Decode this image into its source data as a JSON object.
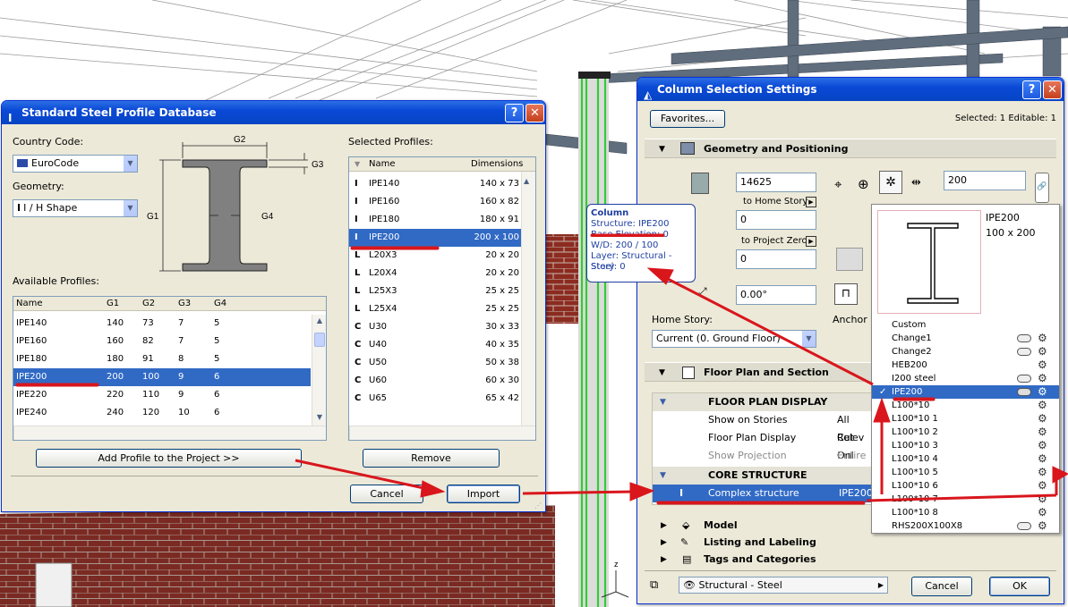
{
  "colors": {
    "selection": "#316ac5",
    "title_bar": "#0a49d6",
    "annotation": "#d9161c",
    "structural": "#33cc33",
    "brick": "#8c2b20"
  },
  "left_dialog": {
    "title": "Standard Steel Profile Database",
    "icon": "i-beam-icon",
    "country_code_label": "Country Code:",
    "country_code_value": "EuroCode",
    "geometry_label": "Geometry:",
    "geometry_value": "I / H Shape",
    "diagram": {
      "g1": "G1",
      "g2": "G2",
      "g3": "G3",
      "g4": "G4"
    },
    "available_label": "Available Profiles:",
    "available_headers": [
      "Name",
      "G1",
      "G2",
      "G3",
      "G4"
    ],
    "available_rows": [
      [
        "IPE140",
        "140",
        "73",
        "7",
        "5"
      ],
      [
        "IPE160",
        "160",
        "82",
        "7",
        "5"
      ],
      [
        "IPE180",
        "180",
        "91",
        "8",
        "5"
      ],
      [
        "IPE200",
        "200",
        "100",
        "9",
        "6"
      ],
      [
        "IPE220",
        "220",
        "110",
        "9",
        "6"
      ],
      [
        "IPE240",
        "240",
        "120",
        "10",
        "6"
      ]
    ],
    "available_selected": 3,
    "selected_label": "Selected Profiles:",
    "selected_headers": [
      "Name",
      "Dimensions"
    ],
    "selected_rows": [
      {
        "icon": "i",
        "name": "IPE140",
        "dim": "140 x 73"
      },
      {
        "icon": "i",
        "name": "IPE160",
        "dim": "160 x 82"
      },
      {
        "icon": "i",
        "name": "IPE180",
        "dim": "180 x 91"
      },
      {
        "icon": "i",
        "name": "IPE200",
        "dim": "200 x 100"
      },
      {
        "icon": "l",
        "name": "L20X3",
        "dim": "20 x 20"
      },
      {
        "icon": "l",
        "name": "L20X4",
        "dim": "20 x 20"
      },
      {
        "icon": "l",
        "name": "L25X3",
        "dim": "25 x 25"
      },
      {
        "icon": "l",
        "name": "L25X4",
        "dim": "25 x 25"
      },
      {
        "icon": "u",
        "name": "U30",
        "dim": "30 x 33"
      },
      {
        "icon": "u",
        "name": "U40",
        "dim": "40 x 35"
      },
      {
        "icon": "u",
        "name": "U50",
        "dim": "50 x 38"
      },
      {
        "icon": "u",
        "name": "U60",
        "dim": "60 x 30"
      },
      {
        "icon": "u",
        "name": "U65",
        "dim": "65 x 42"
      }
    ],
    "selected_selected": 3,
    "add_button": "Add Profile to the Project >>",
    "remove_button": "Remove",
    "cancel_button": "Cancel",
    "import_button": "Import"
  },
  "tooltip": {
    "title": "Column",
    "lines": [
      "Structure: IPE200",
      "Base Elevation: 0",
      "W/D: 200 / 100",
      "Layer: Structural - Steel",
      "Story: 0"
    ]
  },
  "right_dialog": {
    "title": "Column Selection Settings",
    "favorites": "Favorites...",
    "selected_info": "Selected: 1 Editable: 1",
    "geometry_section": "Geometry and Positioning",
    "height_value": "14625",
    "to_home_story": "to Home Story",
    "home_offset_value": "0",
    "to_project_zero": "to Project Zero",
    "project_zero_value": "0",
    "angle_value": "0.00°",
    "width_value": "200",
    "home_story_label": "Home Story:",
    "home_story_value": "Current (0. Ground Floor)",
    "anchor_label": "Anchor P",
    "floor_plan_section": "Floor Plan and Section",
    "floor_plan_display_hdr": "FLOOR PLAN DISPLAY",
    "fp_rows": [
      {
        "label": "Show on Stories",
        "value": "All Relev"
      },
      {
        "label": "Floor Plan Display",
        "value": "Cut Onl"
      },
      {
        "label": "Show Projection",
        "value": "Entire E"
      }
    ],
    "core_structure_hdr": "CORE STRUCTURE",
    "complex_label": "Complex structure",
    "complex_value": "IPE200",
    "model_section": "Model",
    "listing_section": "Listing and Labeling",
    "tags_section": "Tags and Categories",
    "layer_value": "Structural - Steel",
    "cancel_button": "Cancel",
    "ok_button": "OK"
  },
  "profile_popup": {
    "preview_name": "IPE200",
    "preview_dim": "100 x 200",
    "items": [
      {
        "name": "Custom",
        "disk": false,
        "gear": false
      },
      {
        "name": "Change1",
        "disk": true,
        "gear": true
      },
      {
        "name": "Change2",
        "disk": true,
        "gear": true
      },
      {
        "name": "HEB200",
        "disk": false,
        "gear": true
      },
      {
        "name": "I200 steel",
        "disk": true,
        "gear": true
      },
      {
        "name": "IPE200",
        "disk": true,
        "gear": true
      },
      {
        "name": "L100*10",
        "disk": false,
        "gear": true
      },
      {
        "name": "L100*10 1",
        "disk": false,
        "gear": true
      },
      {
        "name": "L100*10 2",
        "disk": false,
        "gear": true
      },
      {
        "name": "L100*10 3",
        "disk": false,
        "gear": true
      },
      {
        "name": "L100*10 4",
        "disk": false,
        "gear": true
      },
      {
        "name": "L100*10 5",
        "disk": false,
        "gear": true
      },
      {
        "name": "L100*10 6",
        "disk": false,
        "gear": true
      },
      {
        "name": "L100*10 7",
        "disk": false,
        "gear": true
      },
      {
        "name": "L100*10 8",
        "disk": false,
        "gear": true
      },
      {
        "name": "RHS200X100X8",
        "disk": true,
        "gear": true
      }
    ],
    "selected": 5
  },
  "viewport": {
    "axis_label": "z"
  }
}
